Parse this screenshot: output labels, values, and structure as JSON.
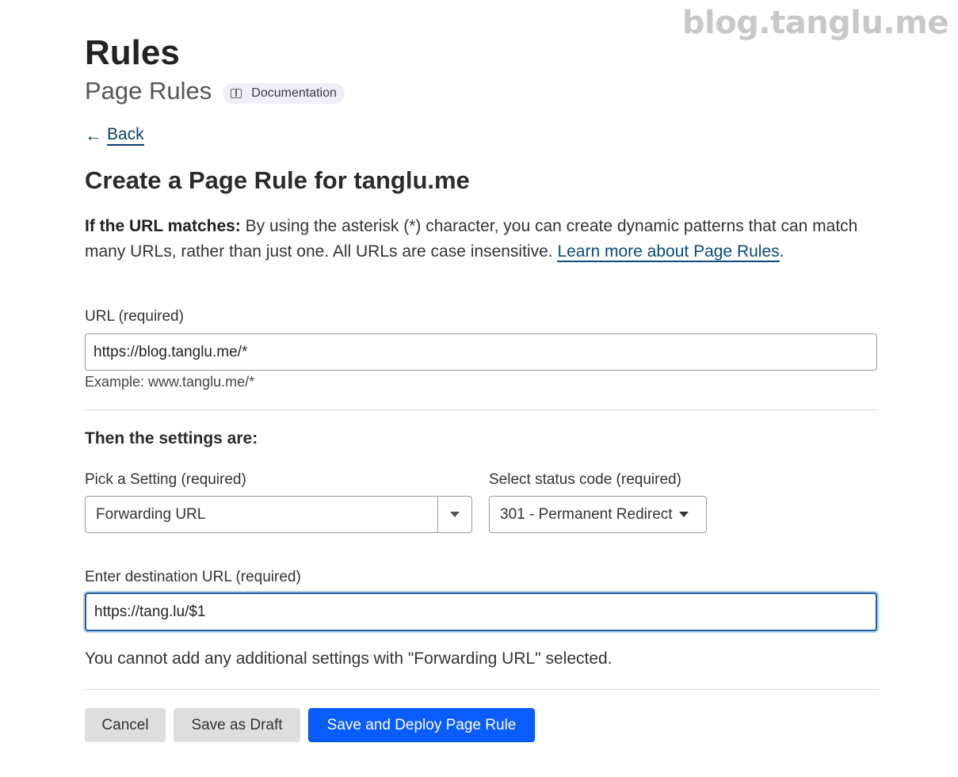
{
  "watermark": "blog.tanglu.me",
  "header": {
    "title": "Rules",
    "subtitle": "Page Rules",
    "doc_label": "Documentation"
  },
  "nav": {
    "back_arrow": "←",
    "back_label": "Back"
  },
  "form": {
    "heading": "Create a Page Rule for tanglu.me",
    "intro_bold": "If the URL matches:",
    "intro_text": " By using the asterisk (*) character, you can create dynamic patterns that can match many URLs, rather than just one. All URLs are case insensitive. ",
    "intro_link": "Learn more about Page Rules",
    "intro_end": ".",
    "url_label": "URL (required)",
    "url_value": "https://blog.tanglu.me/*",
    "url_example": "Example: www.tanglu.me/*",
    "settings_heading": "Then the settings are:",
    "setting_label": "Pick a Setting (required)",
    "setting_value": "Forwarding URL",
    "status_label": "Select status code (required)",
    "status_value": "301 - Permanent Redirect",
    "dest_label": "Enter destination URL (required)",
    "dest_value": "https://tang.lu/$1",
    "note": "You cannot add any additional settings with \"Forwarding URL\" selected."
  },
  "actions": {
    "cancel": "Cancel",
    "draft": "Save as Draft",
    "deploy": "Save and Deploy Page Rule"
  },
  "colors": {
    "primary": "#0a5cff",
    "link": "#0a4a7e",
    "focus_border": "#1f5ea8"
  }
}
